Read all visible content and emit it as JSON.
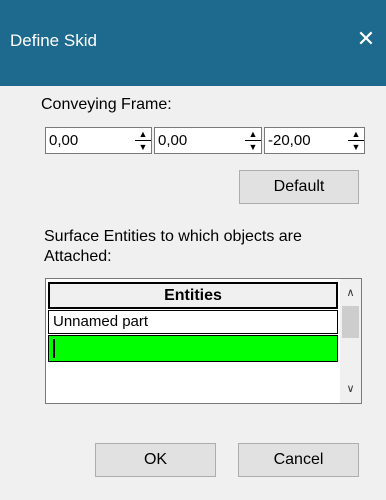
{
  "window": {
    "title": "Define Skid",
    "close_symbol": "✕"
  },
  "conveying_frame": {
    "label": "Conveying Frame:",
    "values": [
      "0,00",
      "0,00",
      "-20,00"
    ]
  },
  "default_button": "Default",
  "surface_label_line1": "Surface Entities to which objects are",
  "surface_label_line2": "Attached:",
  "grid": {
    "header": "Entities",
    "rows": [
      "Unnamed part",
      ""
    ],
    "selected_row_color": "#00ff00"
  },
  "buttons": {
    "ok": "OK",
    "cancel": "Cancel"
  },
  "colors": {
    "titlebar": "#1e6a8f",
    "client": "#f0f0f0"
  }
}
